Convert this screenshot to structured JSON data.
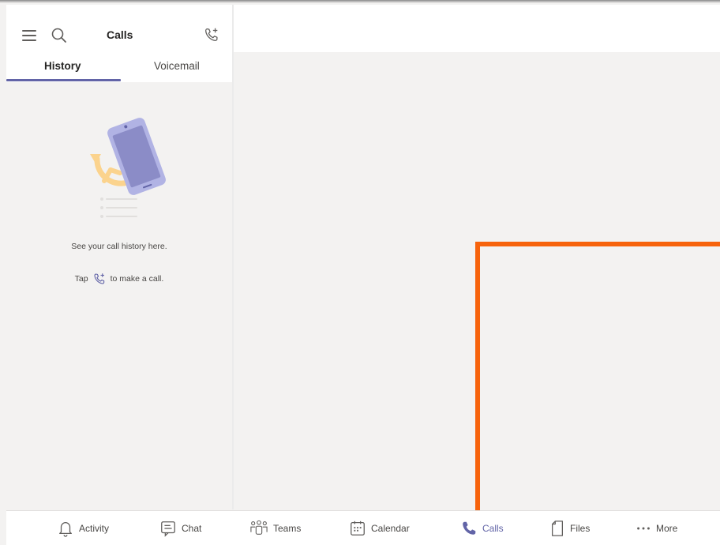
{
  "left_pane": {
    "title": "Calls",
    "tabs": [
      {
        "label": "History",
        "active": true
      },
      {
        "label": "Voicemail",
        "active": false
      }
    ],
    "empty_state": {
      "line1": "See your call history here.",
      "line2_prefix": "Tap",
      "line2_suffix": "to make a call.",
      "inline_icon": "new-call-icon"
    }
  },
  "bottom_nav": {
    "items": [
      {
        "label": "Activity",
        "icon": "bell-icon",
        "active": false
      },
      {
        "label": "Chat",
        "icon": "chat-icon",
        "active": false
      },
      {
        "label": "Teams",
        "icon": "teams-icon",
        "active": false
      },
      {
        "label": "Calendar",
        "icon": "calendar-icon",
        "active": false
      },
      {
        "label": "Calls",
        "icon": "phone-icon",
        "active": true
      },
      {
        "label": "Files",
        "icon": "file-icon",
        "active": false
      },
      {
        "label": "More",
        "icon": "ellipsis-icon",
        "active": false
      }
    ]
  },
  "colors": {
    "accent": "#6264a7",
    "highlight_annotation": "#f7630c",
    "background": "#f3f2f1"
  }
}
